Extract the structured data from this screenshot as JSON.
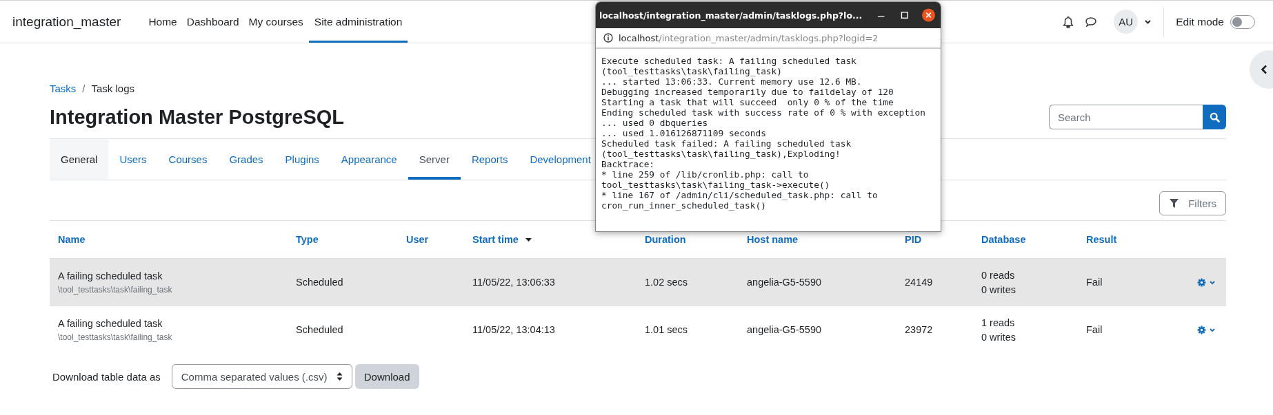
{
  "nav": {
    "brand": "integration_master",
    "items": [
      {
        "label": "Home",
        "selected": false
      },
      {
        "label": "Dashboard",
        "selected": false
      },
      {
        "label": "My courses",
        "selected": false
      },
      {
        "label": "Site administration",
        "selected": true
      }
    ],
    "avatar": "AU",
    "edit_mode": {
      "label": "Edit mode",
      "on": false
    }
  },
  "breadcrumb": [
    {
      "label": "Tasks",
      "kind": "link"
    },
    {
      "label": "/",
      "kind": "separator"
    },
    {
      "label": "Task logs",
      "kind": "current"
    }
  ],
  "title": "Integration Master PostgreSQL",
  "search": {
    "placeholder": "Search"
  },
  "tabs": [
    {
      "label": "General",
      "selected": false,
      "kind": "plain"
    },
    {
      "label": "Users",
      "selected": false,
      "kind": "link"
    },
    {
      "label": "Courses",
      "selected": false,
      "kind": "link"
    },
    {
      "label": "Grades",
      "selected": false,
      "kind": "link"
    },
    {
      "label": "Plugins",
      "selected": false,
      "kind": "link"
    },
    {
      "label": "Appearance",
      "selected": false,
      "kind": "link"
    },
    {
      "label": "Server",
      "selected": true,
      "kind": "link"
    },
    {
      "label": "Reports",
      "selected": false,
      "kind": "link"
    },
    {
      "label": "Development",
      "selected": false,
      "kind": "link"
    }
  ],
  "filters_button": "Filters",
  "table": {
    "columns": [
      {
        "label": "Name",
        "sorted": false
      },
      {
        "label": "Type",
        "sorted": false
      },
      {
        "label": "User",
        "sorted": false
      },
      {
        "label": "Start time",
        "sorted": true
      },
      {
        "label": "Duration",
        "sorted": false
      },
      {
        "label": "Host name",
        "sorted": false
      },
      {
        "label": "PID",
        "sorted": false
      },
      {
        "label": "Database",
        "sorted": false
      },
      {
        "label": "Result",
        "sorted": false
      }
    ],
    "rows": [
      {
        "hovered": true,
        "name": "A failing scheduled task",
        "classname": "\\tool_testtasks\\task\\failing_task",
        "type": "Scheduled",
        "user": "",
        "start": "11/05/22, 13:06:33",
        "duration": "1.02 secs",
        "host": "angelia-G5-5590",
        "pid": "24149",
        "reads": "0 reads",
        "writes": "0 writes",
        "result": "Fail"
      },
      {
        "hovered": false,
        "name": "A failing scheduled task",
        "classname": "\\tool_testtasks\\task\\failing_task",
        "type": "Scheduled",
        "user": "",
        "start": "11/05/22, 13:04:13",
        "duration": "1.01 secs",
        "host": "angelia-G5-5590",
        "pid": "23972",
        "reads": "1 reads",
        "writes": "0 writes",
        "result": "Fail"
      }
    ]
  },
  "download": {
    "label": "Download table data as",
    "format": "Comma separated values (.csv)",
    "button": "Download"
  },
  "popup": {
    "title": "localhost/integration_master/admin/tasklogs.php?lo...",
    "url_host": "localhost",
    "url_path": "/integration_master/admin/tasklogs.php?logid=2",
    "lines": [
      "Execute scheduled task: A failing scheduled task",
      "(tool_testtasks\\task\\failing_task)",
      "... started 13:06:33. Current memory use 12.6 MB.",
      "Debugging increased temporarily due to faildelay of 120",
      "Starting a task that will succeed  only 0 % of the time",
      "Ending scheduled task with success rate of 0 % with exception",
      "... used 0 dbqueries",
      "... used 1.016126871109 seconds",
      "Scheduled task failed: A failing scheduled task",
      "(tool_testtasks\\task\\failing_task),Exploding!",
      "Backtrace:",
      "* line 259 of /lib/cronlib.php: call to",
      "tool_testtasks\\task\\failing_task->execute()",
      "* line 167 of /admin/cli/scheduled_task.php: call to",
      "cron_run_inner_scheduled_task()"
    ]
  }
}
